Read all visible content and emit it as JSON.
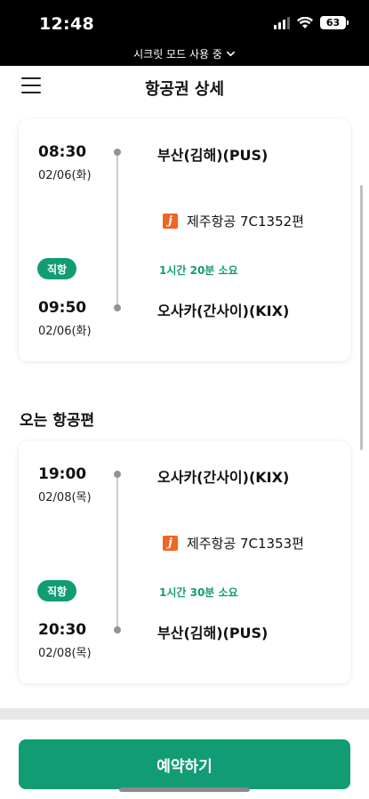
{
  "status_bar": {
    "time": "12:48",
    "battery": "63",
    "incognito_label": "시크릿 모드 사용 중"
  },
  "header": {
    "title": "항공권 상세"
  },
  "outbound": {
    "departure": {
      "time": "08:30",
      "date": "02/06(화)",
      "airport": "부산(김해)(PUS)"
    },
    "airline": {
      "name": "제주항공 7C1352편",
      "logo_letter": "j"
    },
    "badge": "직항",
    "duration": "1시간 20분 소요",
    "arrival": {
      "time": "09:50",
      "date": "02/06(화)",
      "airport": "오사카(간사이)(KIX)"
    }
  },
  "return_section_title": "오는 항공편",
  "return": {
    "departure": {
      "time": "19:00",
      "date": "02/08(목)",
      "airport": "오사카(간사이)(KIX)"
    },
    "airline": {
      "name": "제주항공 7C1353편",
      "logo_letter": "j"
    },
    "badge": "직항",
    "duration": "1시간 30분 소요",
    "arrival": {
      "time": "20:30",
      "date": "02/08(목)",
      "airport": "부산(김해)(PUS)"
    }
  },
  "bottom": {
    "reserve_label": "예약하기"
  },
  "colors": {
    "accent": "#129c74",
    "airline_brand": "#f26522"
  }
}
